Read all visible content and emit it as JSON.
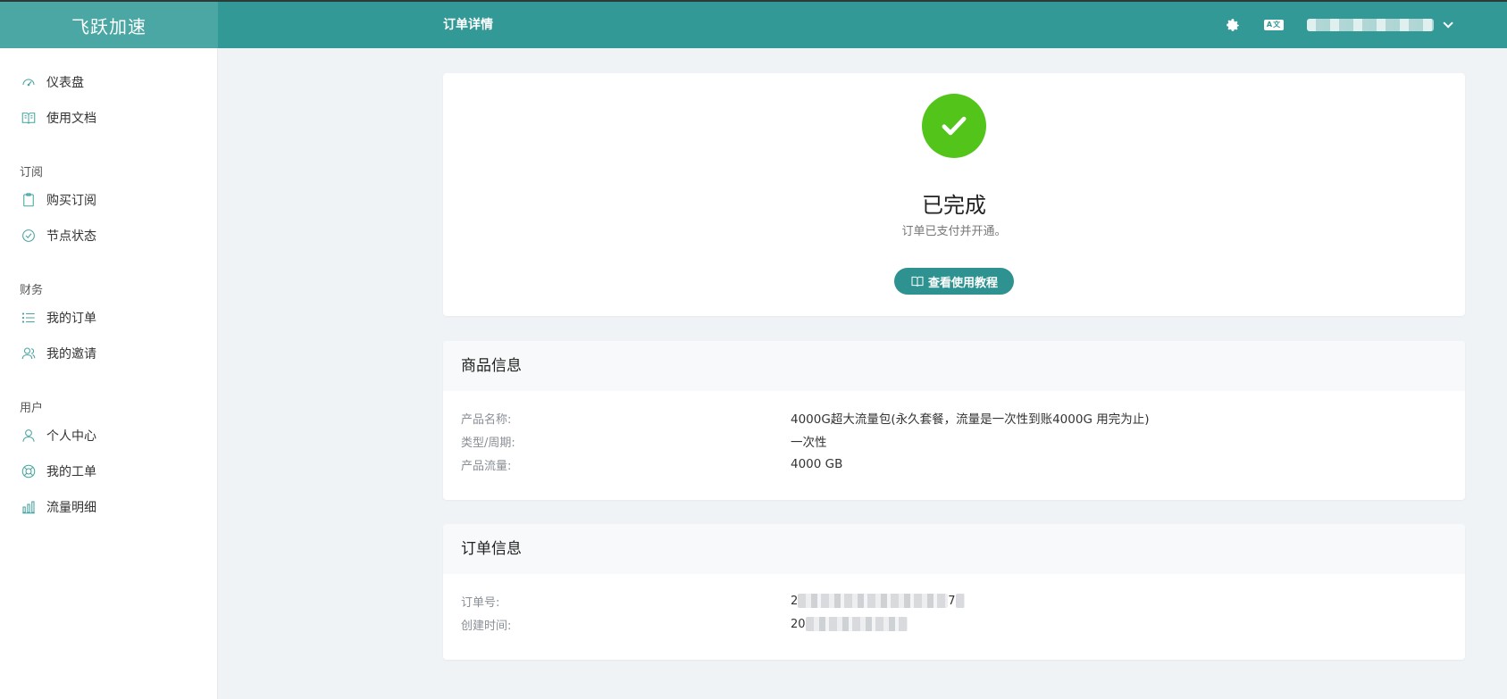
{
  "brand": "飞跃加速",
  "header": {
    "page_title": "订单详情",
    "icons": [
      "gear-icon",
      "language-icon",
      "chevron-down-icon"
    ],
    "lang_glyph": "A文"
  },
  "sidebar": {
    "items": [
      {
        "label": "仪表盘",
        "icon": "dashboard-icon"
      },
      {
        "label": "使用文档",
        "icon": "book-icon"
      },
      {
        "label": "购买订阅",
        "icon": "clipboard-icon"
      },
      {
        "label": "节点状态",
        "icon": "check-circle-icon"
      },
      {
        "label": "我的订单",
        "icon": "list-icon"
      },
      {
        "label": "我的邀请",
        "icon": "users-icon"
      },
      {
        "label": "个人中心",
        "icon": "user-icon"
      },
      {
        "label": "我的工单",
        "icon": "support-icon"
      },
      {
        "label": "流量明细",
        "icon": "bar-chart-icon"
      }
    ],
    "groups": [
      "订阅",
      "财务",
      "用户"
    ]
  },
  "status": {
    "title": "已完成",
    "subtitle": "订单已支付并开通。",
    "button": "查看使用教程"
  },
  "product": {
    "heading": "商品信息",
    "rows": [
      {
        "label": "产品名称:",
        "value": "4000G超大流量包(永久套餐，流量是一次性到账4000G 用完为止)"
      },
      {
        "label": "类型/周期:",
        "value": "一次性"
      },
      {
        "label": "产品流量:",
        "value": "4000 GB"
      }
    ]
  },
  "order": {
    "heading": "订单信息",
    "rows": [
      {
        "label": "订单号:",
        "value_prefix": "2",
        "value_suffix": "7"
      },
      {
        "label": "创建时间:",
        "value_prefix": "20"
      }
    ]
  },
  "colors": {
    "topbar": "#339996",
    "brand_bg": "#4aa7a4",
    "accent": "#47a4a0",
    "success": "#52c41a",
    "button": "#2e9390"
  }
}
